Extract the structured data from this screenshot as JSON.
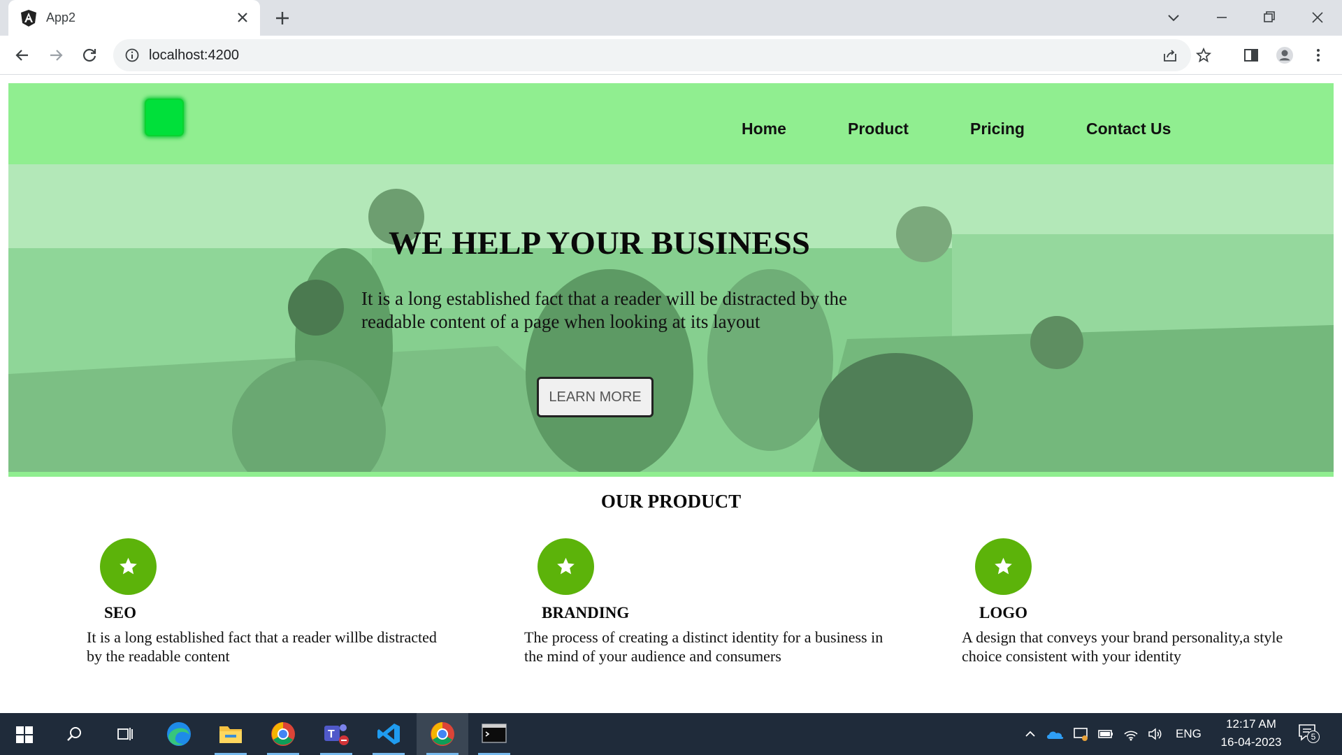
{
  "browser": {
    "tab_title": "App2",
    "url": "localhost:4200"
  },
  "nav": {
    "links": [
      "Home",
      "Product",
      "Pricing",
      "Contact Us"
    ]
  },
  "hero": {
    "title": "WE HELP YOUR BUSINESS",
    "text": "It is a long established fact that a reader will be distracted by the readable content of a page when looking at its layout",
    "button": "LEARN MORE"
  },
  "products": {
    "heading": "OUR PRODUCT",
    "items": [
      {
        "icon": "star-icon",
        "title": "SEO",
        "text": "It is a long established fact that a reader willbe distracted by the readable content"
      },
      {
        "icon": "star-icon",
        "title": "BRANDING",
        "text": "The process of creating a distinct identity for a business in the mind of your audience and consumers"
      },
      {
        "icon": "star-icon",
        "title": "LOGO",
        "text": "A design that conveys your brand personality,a style choice consistent with your identity"
      }
    ]
  },
  "taskbar": {
    "language": "ENG",
    "time": "12:17 AM",
    "date": "16-04-2023",
    "notifications": "5"
  },
  "colors": {
    "nav_bg": "#90ee90",
    "logo": "#00e03a",
    "icon_circle": "#5cb30a",
    "taskbar": "#1f2b3a"
  }
}
